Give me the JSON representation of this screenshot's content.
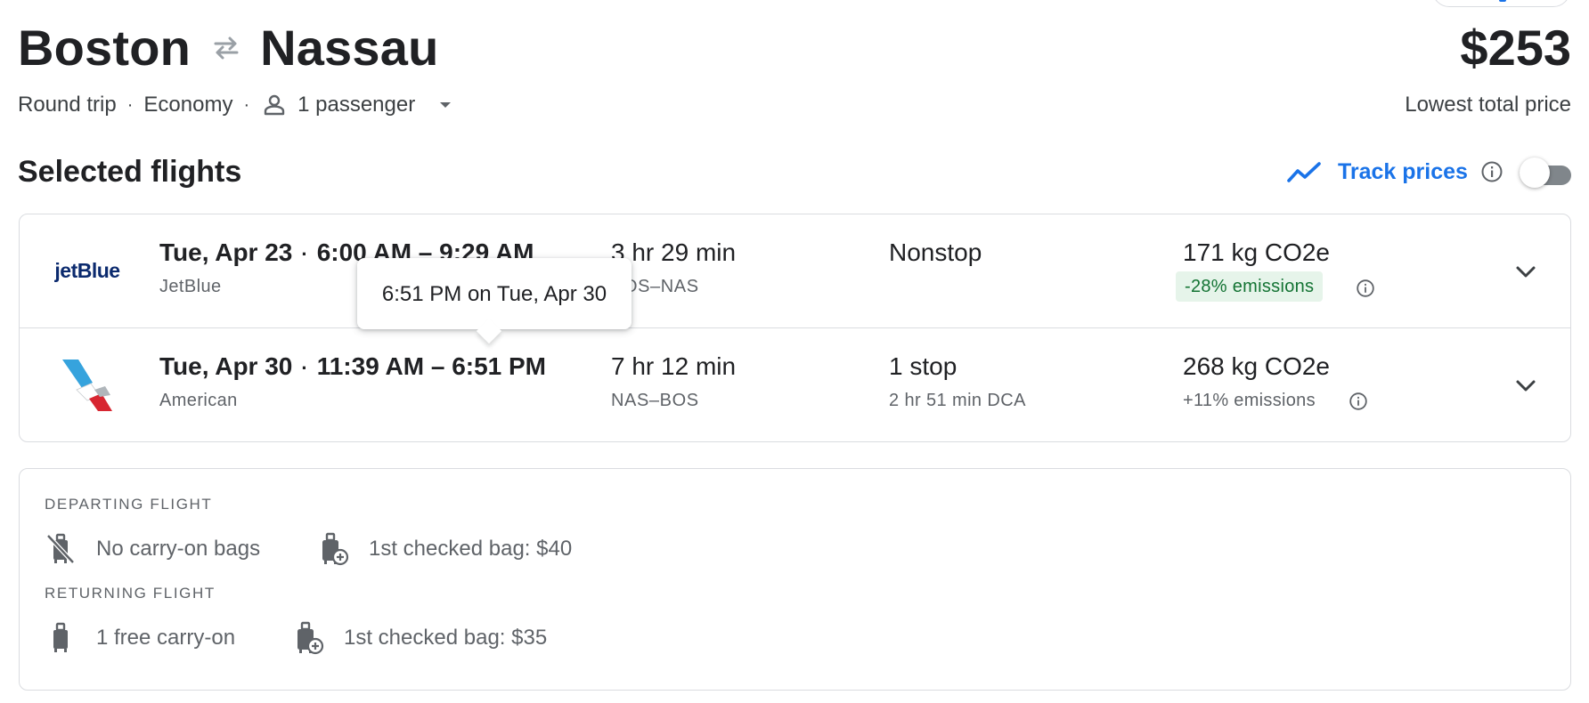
{
  "header": {
    "origin": "Boston",
    "destination": "Nassau",
    "trip_type": "Round trip",
    "cabin": "Economy",
    "passengers": "1 passenger",
    "price": "$253",
    "price_caption": "Lowest total price"
  },
  "selected": {
    "title": "Selected flights",
    "track_label": "Track prices",
    "track_enabled": false
  },
  "flights": [
    {
      "date": "Tue, Apr 23",
      "times": "6:00 AM – 9:29 AM",
      "airline": "JetBlue",
      "logo_text": "jetBlue",
      "duration": "3 hr 29 min",
      "airports": "BOS–NAS",
      "stops": "Nonstop",
      "layover": "",
      "emissions": "171 kg CO2e",
      "emissions_delta": "-28% emissions"
    },
    {
      "date": "Tue, Apr 30",
      "times": "11:39 AM – 6:51 PM",
      "airline": "American",
      "logo_text": "",
      "duration": "7 hr 12 min",
      "airports": "NAS–BOS",
      "stops": "1 stop",
      "layover": "2 hr 51 min DCA",
      "emissions": "268 kg CO2e",
      "emissions_delta": "+11% emissions"
    }
  ],
  "tooltip": {
    "text": "6:51 PM on Tue, Apr 30"
  },
  "baggage": {
    "departing_heading": "DEPARTING FLIGHT",
    "departing_carry": "No carry-on bags",
    "departing_checked": "1st checked bag: $40",
    "returning_heading": "RETURNING FLIGHT",
    "returning_carry": "1 free carry-on",
    "returning_checked": "1st checked bag: $35"
  },
  "colors": {
    "accent": "#1a73e8",
    "text": "#202124",
    "muted": "#5f6368",
    "border": "#dadce0",
    "emissions_good_bg": "#e6f4ea",
    "emissions_good_text": "#137333"
  }
}
